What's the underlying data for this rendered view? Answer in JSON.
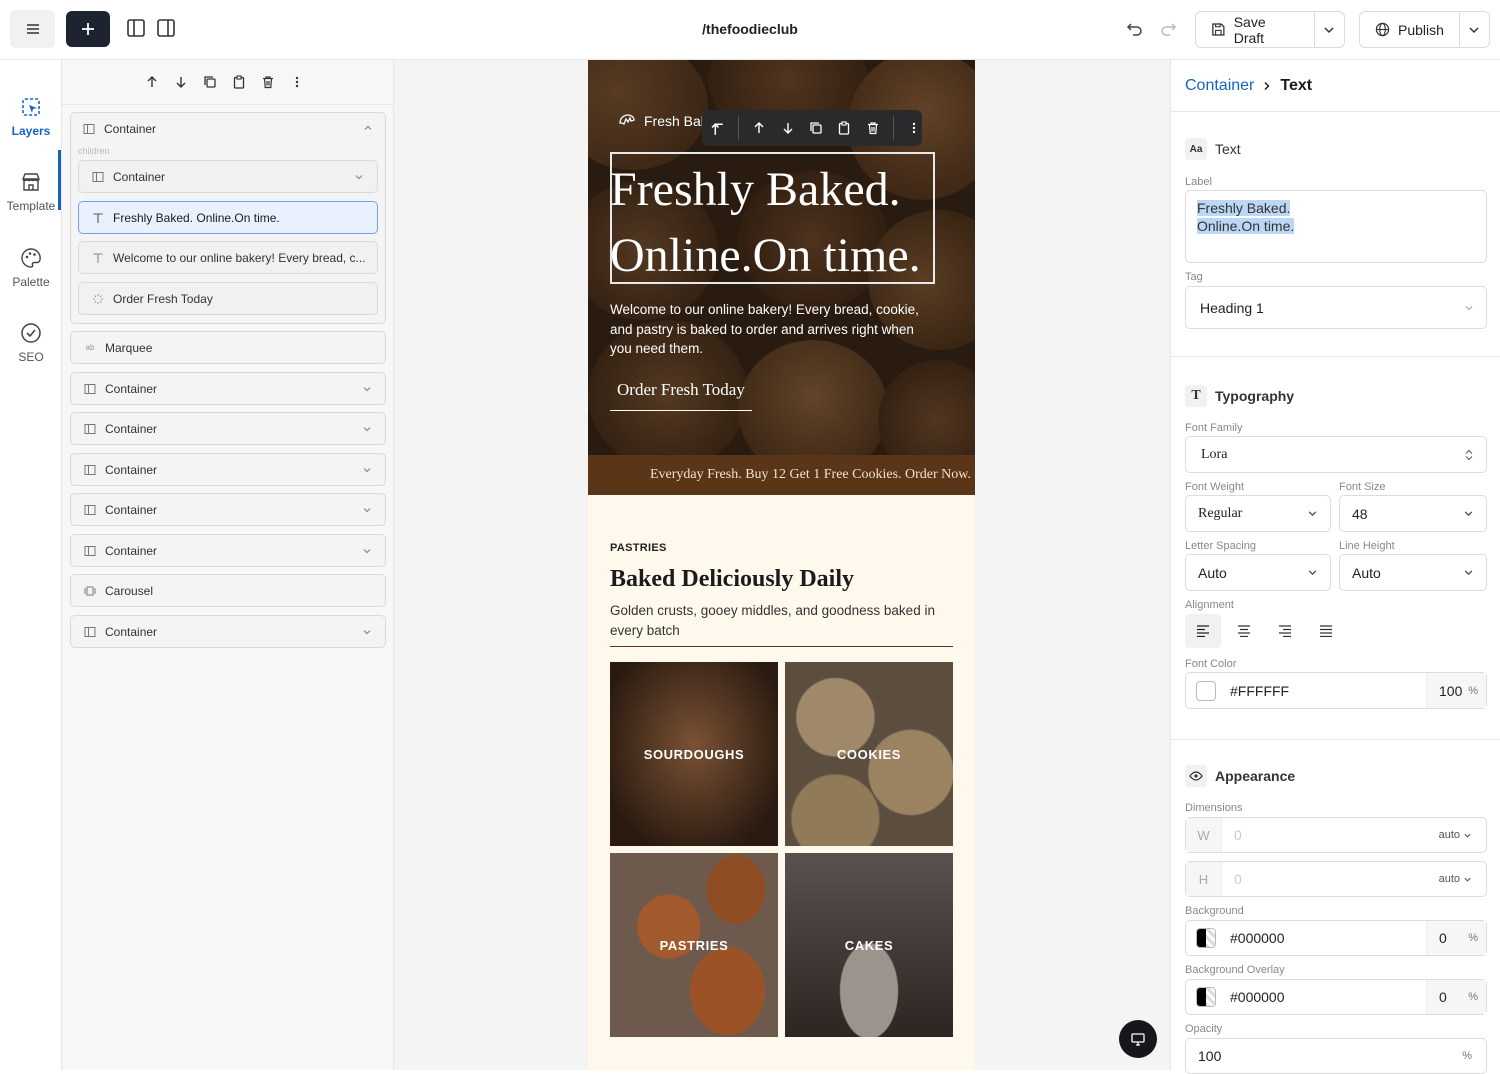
{
  "topbar": {
    "site_path": "/thefoodieclub",
    "save_draft": "Save Draft",
    "publish": "Publish"
  },
  "rail": {
    "layers": "Layers",
    "template": "Template",
    "palette": "Palette",
    "seo": "SEO"
  },
  "layers": {
    "children_label": "children",
    "group_header": "Container",
    "children": [
      {
        "label": "Container",
        "icon": "container-icon"
      },
      {
        "label": "Freshly Baked. Online.On time.",
        "icon": "text-icon"
      },
      {
        "label": "Welcome to our online bakery! Every bread, c...",
        "icon": "text-icon"
      },
      {
        "label": "Order Fresh Today",
        "icon": "button-icon"
      }
    ],
    "items": [
      {
        "label": "Marquee",
        "icon": "marquee-icon"
      },
      {
        "label": "Container",
        "icon": "container-icon"
      },
      {
        "label": "Container",
        "icon": "container-icon"
      },
      {
        "label": "Container",
        "icon": "container-icon"
      },
      {
        "label": "Container",
        "icon": "container-icon"
      },
      {
        "label": "Container",
        "icon": "container-icon"
      },
      {
        "label": "Carousel",
        "icon": "carousel-icon"
      },
      {
        "label": "Container",
        "icon": "container-icon"
      }
    ]
  },
  "preview": {
    "brand": "Fresh Bak",
    "heading_line1": "Freshly Baked.",
    "heading_line2": "Online.On time.",
    "intro": "Welcome to our online bakery! Every bread, cookie, and pastry is baked to order and arrives right when you need them.",
    "cta": "Order Fresh Today",
    "marquee": "Everyday Fresh. Buy 12 Get 1 Free Cookies. Order Now.",
    "eyebrow": "PASTRIES",
    "section_title": "Baked Deliciously Daily",
    "section_text": "Golden crusts, gooey middles, and goodness baked in every batch",
    "tiles": [
      "SOURDOUGHS",
      "COOKIES",
      "PASTRIES",
      "CAKES"
    ]
  },
  "inspector": {
    "crumb_parent": "Container",
    "crumb_current": "Text",
    "text_section": "Text",
    "label_title": "Label",
    "label_line1": "Freshly Baked.",
    "label_line2": "Online.On time.",
    "tag_title": "Tag",
    "tag_value": "Heading 1",
    "typography": "Typography",
    "font_family_label": "Font Family",
    "font_family": "Lora",
    "font_weight_label": "Font Weight",
    "font_weight": "Regular",
    "font_size_label": "Font Size",
    "font_size": "48",
    "letter_spacing_label": "Letter Spacing",
    "letter_spacing": "Auto",
    "line_height_label": "Line Height",
    "line_height": "Auto",
    "alignment_label": "Alignment",
    "font_color_label": "Font Color",
    "font_color": "#FFFFFF",
    "font_color_opacity": "100",
    "appearance": "Appearance",
    "dimensions_label": "Dimensions",
    "w_tag": "W",
    "h_tag": "H",
    "w_placeholder": "0",
    "h_placeholder": "0",
    "w_unit": "auto",
    "h_unit": "auto",
    "background_label": "Background",
    "background": "#000000",
    "background_opacity": "0",
    "overlay_label": "Background Overlay",
    "overlay": "#000000",
    "overlay_opacity": "0",
    "opacity_label": "Opacity",
    "opacity": "100",
    "percent": "%"
  },
  "colors": {
    "accent": "#1565c0",
    "marquee_bg": "#5a3518",
    "section_bg": "#fef9ec",
    "dark_button": "#1d2330"
  }
}
